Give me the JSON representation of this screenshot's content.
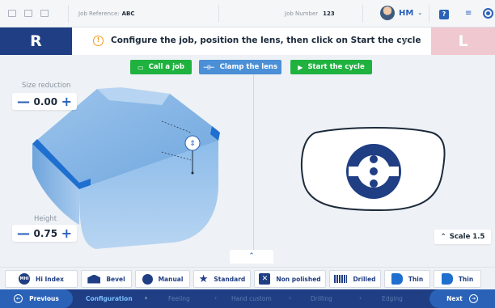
{
  "header": {
    "job_reference_label": "Job Reference:",
    "job_reference_value": "ABC",
    "job_number_label": "Job Number",
    "job_number_value": "123",
    "user_initials": "HM",
    "help_label": "?",
    "list_label": "≡"
  },
  "eye_tabs": {
    "right_label": "R",
    "left_label": "L"
  },
  "message": {
    "text": "Configure the job, position the lens, then click on Start the cycle",
    "close": "×"
  },
  "actions": {
    "call_job": "Call a job",
    "clamp_lens": "Clamp the lens",
    "start_cycle": "Start the cycle"
  },
  "left_panel": {
    "size_reduction_label": "Size reduction",
    "size_reduction_value": "0.00",
    "height_label": "Height",
    "height_value": "0.75",
    "minus": "—",
    "plus": "+"
  },
  "right_panel": {
    "scale_label": "Scale 1.5"
  },
  "options": [
    {
      "label": "Hi Index",
      "icon": "mhi-icon"
    },
    {
      "label": "Bevel",
      "icon": "bevel-icon"
    },
    {
      "label": "Manual",
      "icon": "hand-icon"
    },
    {
      "label": "Standard",
      "icon": "star-icon"
    },
    {
      "label": "Non polished",
      "icon": "non-polished-icon"
    },
    {
      "label": "Drilled",
      "icon": "drill-icon"
    },
    {
      "label": "Thin",
      "icon": "thin-icon"
    },
    {
      "label": "Thin",
      "icon": "thin-icon"
    }
  ],
  "nav": {
    "previous": "Previous",
    "next": "Next",
    "steps": [
      "Configuration",
      "Feeling",
      "Hand custom",
      "Drilling",
      "Edging"
    ]
  },
  "colors": {
    "primary": "#1f3e84",
    "accent_blue": "#2a62b8",
    "green": "#1fb23f",
    "left_tab": "#f0c8cf",
    "warning": "#f29a1a"
  }
}
